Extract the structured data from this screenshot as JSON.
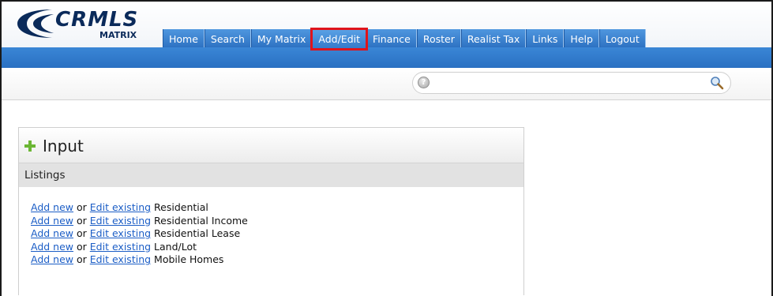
{
  "logo": {
    "name": "CRMLS",
    "subtitle": "MATRIX"
  },
  "nav": {
    "items": [
      {
        "label": "Home"
      },
      {
        "label": "Search"
      },
      {
        "label": "My Matrix"
      },
      {
        "label": "Add/Edit",
        "active": true,
        "highlight_color": "#e0141b"
      },
      {
        "label": "Finance"
      },
      {
        "label": "Roster"
      },
      {
        "label": "Realist Tax"
      },
      {
        "label": "Links"
      },
      {
        "label": "Help"
      },
      {
        "label": "Logout"
      }
    ]
  },
  "search": {
    "value": "",
    "placeholder": "",
    "help_icon": "help-circle-icon",
    "submit_icon": "magnifier-icon"
  },
  "panel": {
    "icon": "plus-icon",
    "title": "Input",
    "section": "Listings",
    "rows": [
      {
        "add": "Add new",
        "or": "or",
        "edit": "Edit existing",
        "type": "Residential"
      },
      {
        "add": "Add new",
        "or": "or",
        "edit": "Edit existing",
        "type": "Residential Income"
      },
      {
        "add": "Add new",
        "or": "or",
        "edit": "Edit existing",
        "type": "Residential Lease"
      },
      {
        "add": "Add new",
        "or": "or",
        "edit": "Edit existing",
        "type": "Land/Lot"
      },
      {
        "add": "Add new",
        "or": "or",
        "edit": "Edit existing",
        "type": "Mobile Homes"
      }
    ]
  },
  "colors": {
    "nav_blue": "#2b6fc0",
    "link_blue": "#1c5ec6",
    "logo_navy": "#0a2a5a",
    "plus_green": "#6bb634"
  }
}
